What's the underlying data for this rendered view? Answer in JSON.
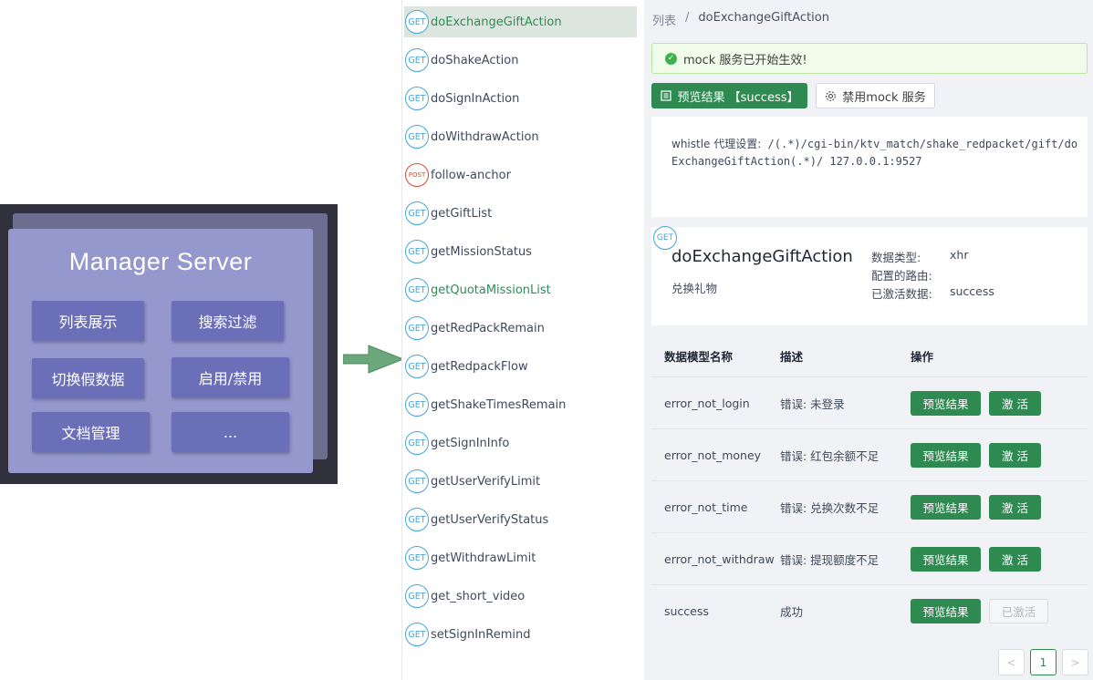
{
  "diagram": {
    "title": "Manager Server",
    "buttons": [
      "列表展示",
      "搜索过滤",
      "切换假数据",
      "启用/禁用",
      "文档管理",
      "..."
    ]
  },
  "api_list": [
    {
      "method": "GET",
      "name": "doExchangeGiftAction",
      "active": true
    },
    {
      "method": "GET",
      "name": "doShakeAction"
    },
    {
      "method": "GET",
      "name": "doSignInAction"
    },
    {
      "method": "GET",
      "name": "doWithdrawAction"
    },
    {
      "method": "POST",
      "name": "follow-anchor"
    },
    {
      "method": "GET",
      "name": "getGiftList"
    },
    {
      "method": "GET",
      "name": "getMissionStatus"
    },
    {
      "method": "GET",
      "name": "getQuotaMissionList",
      "highlight": true
    },
    {
      "method": "GET",
      "name": "getRedPackRemain"
    },
    {
      "method": "GET",
      "name": "getRedpackFlow"
    },
    {
      "method": "GET",
      "name": "getShakeTimesRemain"
    },
    {
      "method": "GET",
      "name": "getSignInInfo"
    },
    {
      "method": "GET",
      "name": "getUserVerifyLimit"
    },
    {
      "method": "GET",
      "name": "getUserVerifyStatus"
    },
    {
      "method": "GET",
      "name": "getWithdrawLimit"
    },
    {
      "method": "GET",
      "name": "get_short_video"
    },
    {
      "method": "GET",
      "name": "setSignInRemind"
    }
  ],
  "breadcrumb": {
    "root": "列表",
    "sep": "/",
    "current": "doExchangeGiftAction"
  },
  "alert": {
    "text": "mock 服务已开始生效!"
  },
  "preview_button": "预览结果 【success】",
  "disable_button": "禁用mock 服务",
  "proxy": {
    "label": "whistle 代理设置:",
    "rule": " /(.*)/cgi-bin/ktv_match/shake_redpacket/gift/doExchangeGiftAction(.*)/ 127.0.0.1:9527"
  },
  "detail": {
    "method": "GET",
    "name": "doExchangeGiftAction",
    "desc": "兑换礼物",
    "meta": [
      {
        "key": "数据类型:",
        "value": "xhr"
      },
      {
        "key": "配置的路由:",
        "value": ""
      },
      {
        "key": "已激活数据:",
        "value": "success"
      }
    ]
  },
  "table": {
    "headers": [
      "数据模型名称",
      "描述",
      "操作"
    ],
    "rows": [
      {
        "name": "error_not_login",
        "desc": "错误: 未登录",
        "preview": "预览结果",
        "activate": "激 活",
        "active": false
      },
      {
        "name": "error_not_money",
        "desc": "错误: 红包余额不足",
        "preview": "预览结果",
        "activate": "激 活",
        "active": false
      },
      {
        "name": "error_not_time",
        "desc": "错误: 兑换次数不足",
        "preview": "预览结果",
        "activate": "激 活",
        "active": false
      },
      {
        "name": "error_not_withdraw",
        "desc": "错误: 提现额度不足",
        "preview": "预览结果",
        "activate": "激 活",
        "active": false
      },
      {
        "name": "success",
        "desc": "成功",
        "preview": "预览结果",
        "activate": "已激活",
        "active": true
      }
    ]
  },
  "pagination": {
    "prev": "<",
    "page": "1",
    "next": ">"
  },
  "colors": {
    "primary": "#2f8a52",
    "get_badge": "#45a6d6",
    "post_badge": "#d84a35",
    "diagram_card": "#9598cc"
  }
}
